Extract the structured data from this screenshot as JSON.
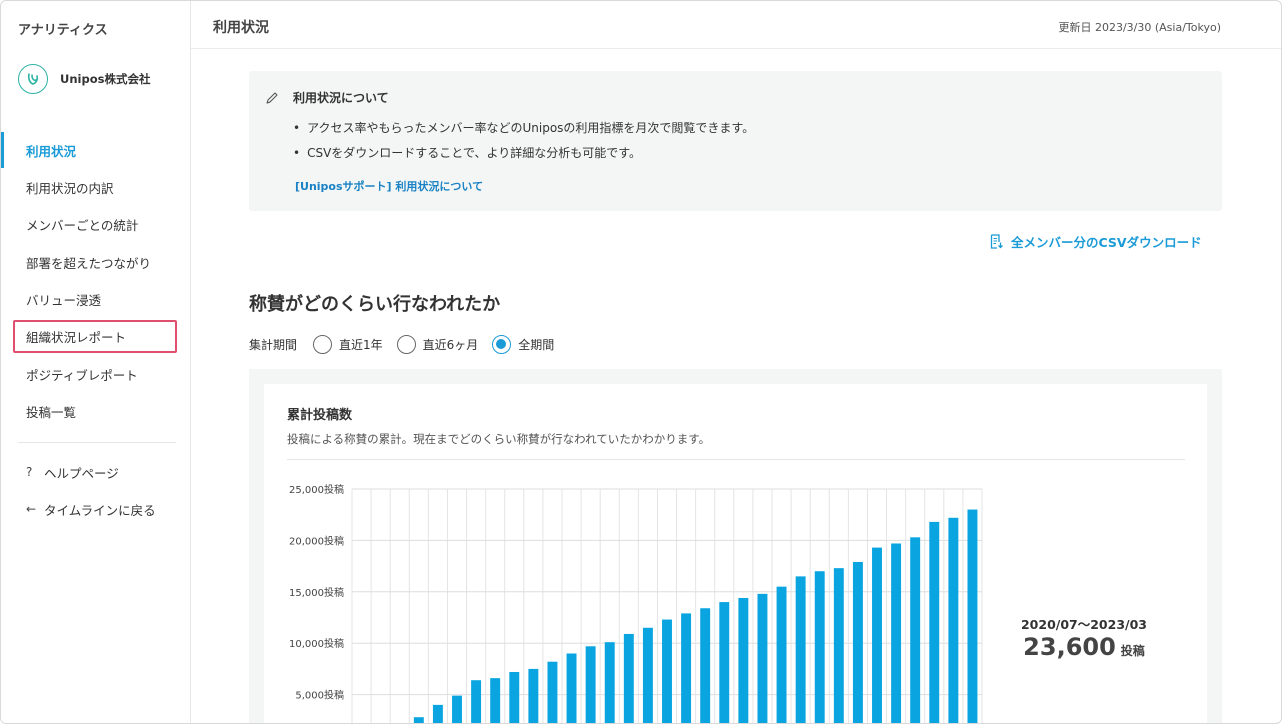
{
  "sidebar": {
    "app_title": "アナリティクス",
    "org_name": "Unipos株式会社",
    "items": [
      {
        "label": "利用状況",
        "active": true
      },
      {
        "label": "利用状況の内訳"
      },
      {
        "label": "メンバーごとの統計"
      },
      {
        "label": "部署を超えたつながり"
      },
      {
        "label": "バリュー浸透"
      },
      {
        "label": "組織状況レポート",
        "highlighted": true
      },
      {
        "label": "ポジティブレポート"
      },
      {
        "label": "投稿一覧"
      }
    ],
    "help": {
      "icon": "question-icon",
      "icon_glyph": "?",
      "label": "ヘルプページ"
    },
    "back": {
      "icon": "arrow-left-icon",
      "icon_glyph": "←",
      "label": "タイムラインに戻る"
    }
  },
  "header": {
    "title": "利用状況",
    "updated": "更新日 2023/3/30 (Asia/Tokyo)"
  },
  "info": {
    "title": "利用状況について",
    "bullets": [
      "アクセス率やもらったメンバー率などのUniposの利用指標を月次で閲覧できます。",
      "CSVをダウンロードすることで、より詳細な分析も可能です。"
    ],
    "link": "[Uniposサポート] 利用状況について"
  },
  "csv_download": "全メンバー分のCSVダウンロード",
  "section": {
    "title": "称賛がどのくらい行なわれたか",
    "period_label": "集計期間",
    "period_options": [
      {
        "label": "直近1年",
        "checked": false
      },
      {
        "label": "直近6ヶ月",
        "checked": false
      },
      {
        "label": "全期間",
        "checked": true
      }
    ]
  },
  "card": {
    "title": "累計投稿数",
    "description": "投稿による称賛の累計。現在までどのくらい称賛が行なわれていたかわかります。"
  },
  "summary": {
    "period": "2020/07〜2023/03",
    "total": "23,600",
    "unit": "投稿"
  },
  "colors": {
    "accent": "#1a9bd7",
    "bar": "#0aa5e0",
    "highlight_border": "#e0506e"
  },
  "chart_data": {
    "type": "bar",
    "title": "累計投稿数",
    "ylim": [
      0,
      25000
    ],
    "yticks": [
      {
        "value": 5000,
        "label": "5,000投稿"
      },
      {
        "value": 10000,
        "label": "10,000投稿"
      },
      {
        "value": 15000,
        "label": "15,000投稿"
      },
      {
        "value": 20000,
        "label": "20,000投稿"
      },
      {
        "value": 25000,
        "label": "25,000投稿"
      }
    ],
    "grid": true,
    "values": [
      0,
      0,
      0,
      2800,
      4000,
      4900,
      6400,
      6600,
      7200,
      7500,
      8200,
      9000,
      9700,
      10100,
      10900,
      11500,
      12300,
      12900,
      13400,
      14000,
      14400,
      14800,
      15500,
      16500,
      17000,
      17300,
      17900,
      19300,
      19700,
      20300,
      21800,
      22200,
      23000
    ]
  }
}
